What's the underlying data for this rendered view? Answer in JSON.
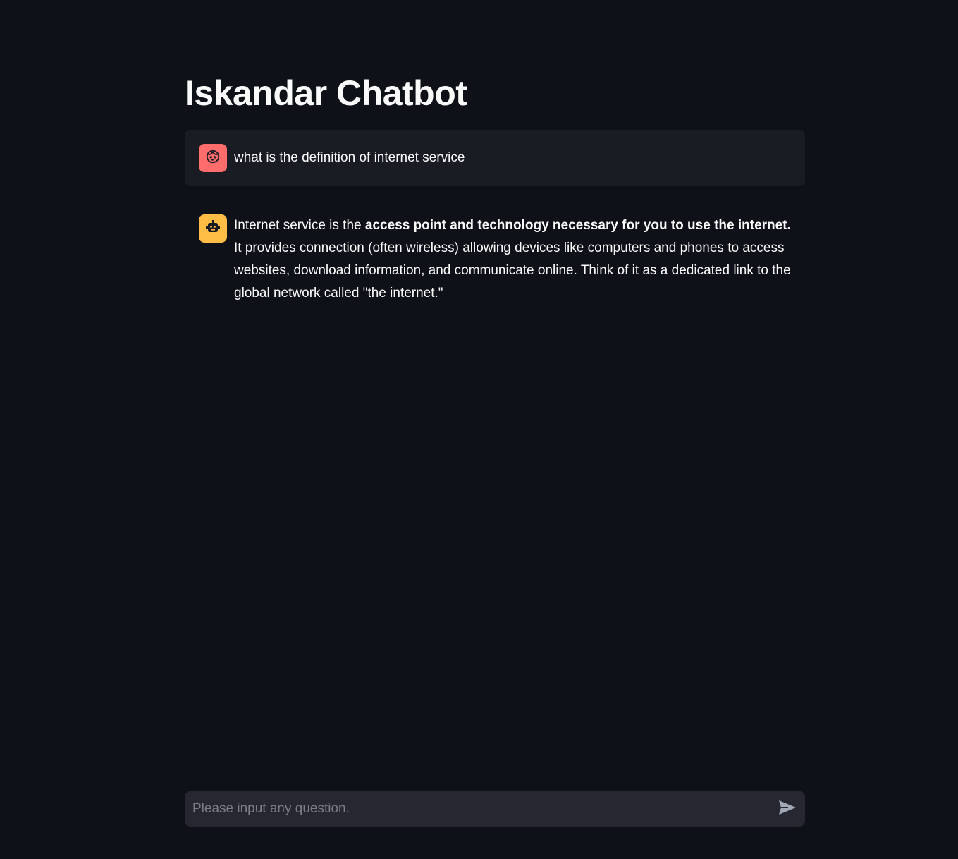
{
  "page": {
    "title": "Iskandar Chatbot"
  },
  "messages": [
    {
      "role": "user",
      "avatar_icon": "user-face-icon",
      "avatar_color": "#ff6c6c",
      "text": "what is the definition of internet service"
    },
    {
      "role": "assistant",
      "avatar_icon": "robot-icon",
      "avatar_color": "#ffbd45",
      "text_before": "Internet service is the ",
      "text_bold": "access point and technology necessary for you to use the internet.",
      "text_after": " It provides connection (often wireless) allowing devices like computers and phones to access websites, download information, and communicate online. Think of it as a dedicated link to the global network called \"the internet.\""
    }
  ],
  "chat_input": {
    "placeholder": "Please input any question.",
    "value": "",
    "send_icon": "send-icon"
  },
  "colors": {
    "background": "#0e1117",
    "user_bubble": "#1a1c24",
    "input_background": "#262730",
    "text": "#fafafa"
  }
}
